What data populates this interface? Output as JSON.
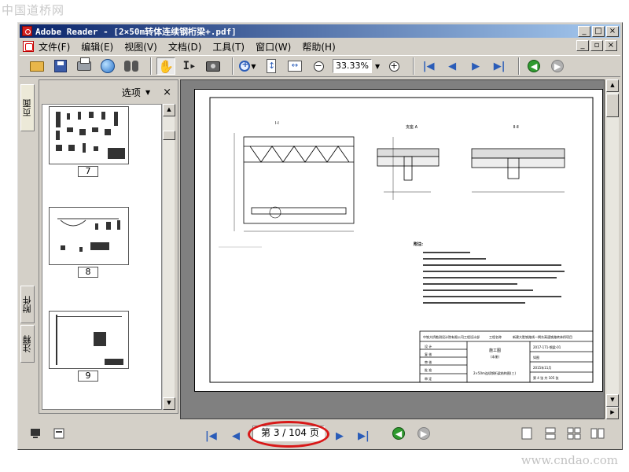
{
  "watermark_top": "中国道桥网",
  "watermark_bottom": "www.cndao.com",
  "window": {
    "title": "Adobe Reader - [2×50m转体连续钢桁梁+.pdf]",
    "buttons": {
      "minimize": "_",
      "maximize": "□",
      "close": "×"
    }
  },
  "menu": {
    "items": [
      "文件(F)",
      "编辑(E)",
      "视图(V)",
      "文档(D)",
      "工具(T)",
      "窗口(W)",
      "帮助(H)"
    ],
    "doc_buttons": {
      "minimize": "_",
      "restore": "▫",
      "close": "×"
    }
  },
  "toolbar": {
    "zoom_value": "33.33%",
    "icons": [
      "open-icon",
      "save-icon",
      "print-icon",
      "email-icon",
      "search-icon",
      "hand-tool-icon",
      "select-text-icon",
      "snapshot-icon",
      "zoom-in-icon",
      "fit-page-icon",
      "fit-width-icon",
      "zoom-out-icon",
      "zoom-in-plus-icon",
      "first-page-icon",
      "prev-page-icon",
      "next-page-icon",
      "last-page-icon",
      "go-back-icon",
      "go-forward-icon"
    ]
  },
  "side_tabs": {
    "pages": "页面",
    "attachments": "附件",
    "comments": "注释"
  },
  "thumbnails": {
    "options_label": "选项",
    "close_label": "×",
    "items": [
      {
        "number": "7"
      },
      {
        "number": "8"
      },
      {
        "number": "9"
      }
    ]
  },
  "drawing": {
    "section_left": "Ⅰ-Ⅰ",
    "section_center": "支座 A",
    "section_right": "Ⅱ-Ⅱ",
    "notes_title": "附注:",
    "title_block": {
      "company": "中铁大桥勘测设计院有限公司工程设计部",
      "project_label": "工程名称",
      "project": "新建大胜铁路线—揭东高速铁路转体桥项目",
      "drawing_name": "2×50m连续钢桁梁结构图(三)",
      "phase": "施工图",
      "part": "(本册)",
      "sheet": "第 4 张 共 105 张",
      "date": "2015年11月",
      "scale": "如图",
      "drawing_no": "2017-171-钢梁-01",
      "rows": [
        "设 计",
        "复 核",
        "审 核",
        "批 准",
        "审 定"
      ]
    }
  },
  "status": {
    "page_text": "第 3 / 104 页"
  }
}
